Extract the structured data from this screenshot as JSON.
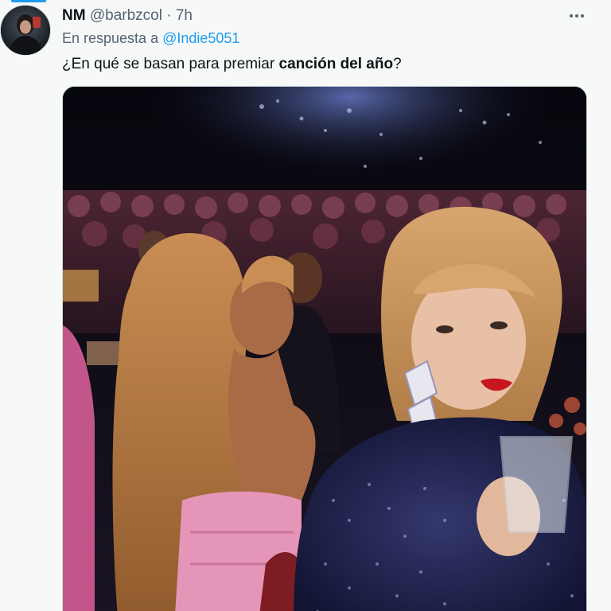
{
  "tweet": {
    "display_name": "NM",
    "handle": "@barbzcol",
    "separator": "·",
    "time": "7h",
    "reply_prefix": "En respuesta a",
    "reply_mention": "@Indie5051",
    "text_before": "¿En qué se basan para premiar ",
    "text_bold": "canción del año",
    "text_after": "?",
    "more_icon": "more-horizontal-icon",
    "avatar_icon": "avatar-photo"
  },
  "colors": {
    "accent": "#1d9bf0",
    "text_primary": "#0f1419",
    "text_secondary": "#536471",
    "background": "#f7f9f9"
  }
}
